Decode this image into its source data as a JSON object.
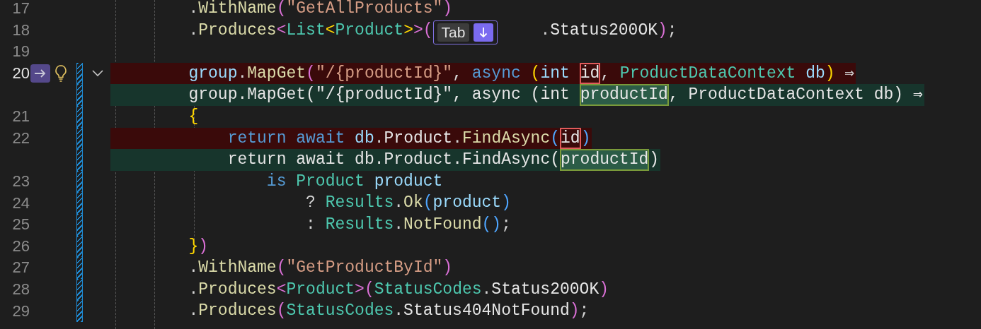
{
  "editor": {
    "lines": [
      {
        "number": "17",
        "kind": "normal",
        "active": false,
        "modified": false,
        "text": "        .WithName(\"GetAllProducts\")"
      },
      {
        "number": "18",
        "kind": "normal",
        "active": false,
        "modified": false,
        "text": "        .Produces<List<Product>>(",
        "hint": {
          "key": "Tab"
        },
        "after": ".Status200OK);"
      },
      {
        "number": "19",
        "kind": "normal",
        "active": false,
        "modified": false
      },
      {
        "number": "20",
        "kind": "removed",
        "active": true,
        "modified": true,
        "expanded": true,
        "text": "        group.MapGet(\"/{productId}\", async (int ",
        "changed": "id",
        "after": ", ProductDataContext db) ⇒"
      },
      {
        "kind": "added",
        "modified": true,
        "text": "        group.MapGet(\"/{productId}\", async (int ",
        "changed": "productId",
        "after": ", ProductDataContext db) ⇒"
      },
      {
        "number": "21",
        "kind": "normal",
        "active": false,
        "modified": true,
        "text": "        {"
      },
      {
        "number": "22",
        "kind": "removed",
        "active": false,
        "modified": true,
        "text": "            return await db.Product.FindAsync(",
        "changed": "id",
        "after": ")"
      },
      {
        "kind": "added",
        "modified": true,
        "text": "            return await db.Product.FindAsync(",
        "changed": "productId",
        "after": ")"
      },
      {
        "number": "23",
        "kind": "normal",
        "active": false,
        "modified": true,
        "text": "                is Product product"
      },
      {
        "number": "24",
        "kind": "normal",
        "active": false,
        "modified": true,
        "text": "                    ? Results.Ok(product)"
      },
      {
        "number": "25",
        "kind": "normal",
        "active": false,
        "modified": true,
        "text": "                    : Results.NotFound();"
      },
      {
        "number": "26",
        "kind": "normal",
        "active": false,
        "modified": true,
        "text": "        })"
      },
      {
        "number": "27",
        "kind": "normal",
        "active": false,
        "modified": true,
        "text": "        .WithName(\"GetProductById\")"
      },
      {
        "number": "28",
        "kind": "normal",
        "active": false,
        "modified": true,
        "text": "        .Produces<Product>(StatusCodes.Status200OK)"
      },
      {
        "number": "29",
        "kind": "normal",
        "active": false,
        "modified": true,
        "text": "        .Produces(StatusCodes.Status404NotFound);"
      }
    ]
  }
}
